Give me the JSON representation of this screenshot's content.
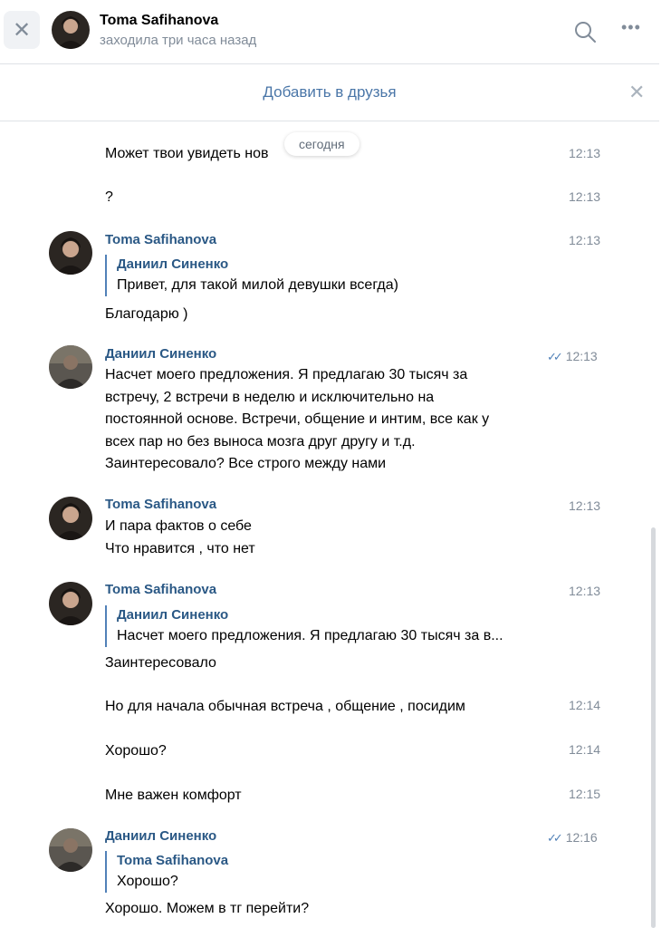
{
  "header": {
    "name": "Toma Safihanova",
    "status": "заходила три часа назад"
  },
  "friend_bar": {
    "label": "Добавить в друзья"
  },
  "date_divider": "сегодня",
  "messages": [
    {
      "text": "Может твои увидеть нов",
      "time": "12:13"
    },
    {
      "text": "?",
      "time": "12:13"
    },
    {
      "author": "Toma Safihanova",
      "time": "12:13",
      "quote_author": "Даниил Синенко",
      "quote_text": "Привет, для такой милой девушки всегда)",
      "text": "Благодарю )"
    },
    {
      "author": "Даниил Синенко",
      "time": "12:13",
      "read": true,
      "lines": [
        "Насчет моего предложения. Я предлагаю 30 тысяч за",
        "встречу, 2 встречи в неделю и исключительно на",
        "постоянной основе. Встречи, общение и интим, все как у",
        "всех пар но без выноса мозга друг другу и т.д.",
        "Заинтересовало? Все строго между нами"
      ]
    },
    {
      "author": "Toma Safihanova",
      "time": "12:13",
      "lines": [
        "И пара фактов о себе",
        "Что нравится , что нет"
      ]
    },
    {
      "author": "Toma Safihanova",
      "time": "12:13",
      "quote_author": "Даниил Синенко",
      "quote_text": "Насчет моего предложения. Я предлагаю 30 тысяч за в...",
      "text": "Заинтересовало"
    },
    {
      "text": "Но для начала обычная встреча , общение , посидим",
      "time": "12:14"
    },
    {
      "text": "Хорошо?",
      "time": "12:14"
    },
    {
      "text": "Мне важен комфорт",
      "time": "12:15"
    },
    {
      "author": "Даниил Синенко",
      "time": "12:16",
      "read": true,
      "quote_author": "Toma Safihanova",
      "quote_text": "Хорошо?",
      "text": "Хорошо. Можем в тг перейти?"
    }
  ],
  "colors": {
    "link": "#2a5885",
    "accent": "#5181b8",
    "muted": "#818c99"
  },
  "icons": {
    "close": "close-icon",
    "search": "search-icon",
    "more": "more-icon",
    "read": "read-check-icon"
  }
}
